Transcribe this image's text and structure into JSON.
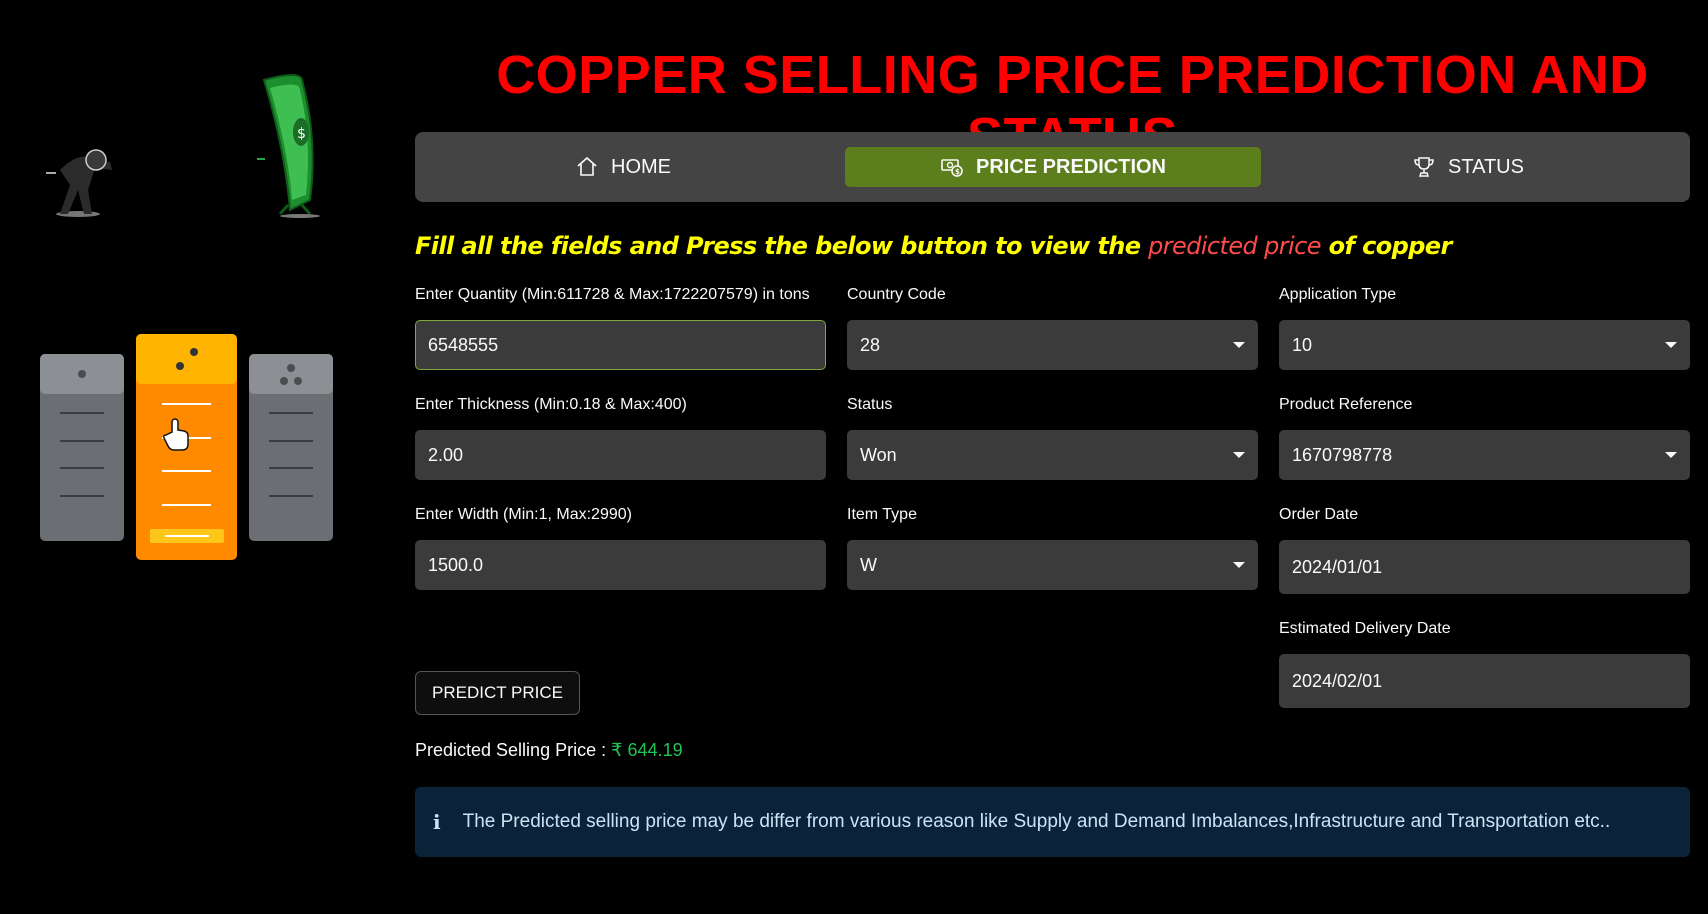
{
  "title": "COPPER SELLING PRICE PREDICTION AND STATUS",
  "nav": {
    "home": "HOME",
    "price_prediction": "PRICE PREDICTION",
    "status": "STATUS",
    "active": "price_prediction",
    "active_color": "#5c7e1c"
  },
  "instruction": {
    "pre": "Fill all the fields and Press the below button to view the ",
    "highlight": "predicted price",
    "post": " of copper"
  },
  "fields": {
    "quantity": {
      "label": "Enter Quantity (Min:611728 & Max:1722207579) in tons",
      "value": "6548555"
    },
    "thickness": {
      "label": "Enter Thickness (Min:0.18 & Max:400)",
      "value": "2.00"
    },
    "width": {
      "label": "Enter Width (Min:1, Max:2990)",
      "value": "1500.0"
    },
    "country_code": {
      "label": "Country Code",
      "value": "28"
    },
    "status": {
      "label": "Status",
      "value": "Won"
    },
    "item_type": {
      "label": "Item Type",
      "value": "W"
    },
    "application_type": {
      "label": "Application Type",
      "value": "10"
    },
    "product_reference": {
      "label": "Product Reference",
      "value": "1670798778"
    },
    "order_date": {
      "label": "Order Date",
      "value": "2024/01/01"
    },
    "delivery_date": {
      "label": "Estimated Delivery Date",
      "value": "2024/02/01"
    }
  },
  "predict_button": "PREDICT PRICE",
  "result": {
    "label": "Predicted Selling Price : ",
    "value": "₹ 644.19"
  },
  "info": {
    "icon": "info-icon",
    "text": "The Predicted selling price may be differ from various reason like Supply and Demand Imbalances,Infrastructure and Transportation etc.."
  },
  "colors": {
    "title": "#ff0000",
    "instruction": "#ffff00",
    "highlight": "#ff4b4b",
    "price": "#21c354",
    "info_bg": "#0b2338"
  }
}
